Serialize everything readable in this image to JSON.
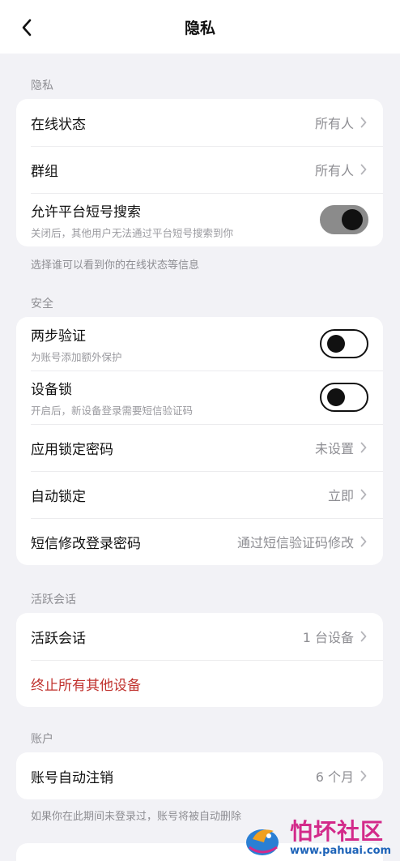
{
  "header": {
    "title": "隐私",
    "back_icon": "chevron-left-icon"
  },
  "privacy": {
    "label": "隐私",
    "online_status": {
      "title": "在线状态",
      "value": "所有人"
    },
    "groups": {
      "title": "群组",
      "value": "所有人"
    },
    "short_id_search": {
      "title": "允许平台短号搜索",
      "subtitle": "关闭后，其他用户无法通过平台短号搜索到你",
      "enabled": true
    },
    "footnote": "选择谁可以看到你的在线状态等信息"
  },
  "security": {
    "label": "安全",
    "two_step": {
      "title": "两步验证",
      "subtitle": "为账号添加额外保护",
      "enabled": false
    },
    "device_lock": {
      "title": "设备锁",
      "subtitle": "开启后，新设备登录需要短信验证码",
      "enabled": false
    },
    "app_lock_passcode": {
      "title": "应用锁定密码",
      "value": "未设置"
    },
    "auto_lock": {
      "title": "自动锁定",
      "value": "立即"
    },
    "sms_change_password": {
      "title": "短信修改登录密码",
      "value": "通过短信验证码修改"
    }
  },
  "sessions": {
    "label": "活跃会话",
    "active_sessions": {
      "title": "活跃会话",
      "value": "1 台设备"
    },
    "terminate_label": "终止所有其他设备"
  },
  "account": {
    "label": "账户",
    "auto_delete": {
      "title": "账号自动注销",
      "value": "6 个月"
    },
    "footnote": "如果你在此期间未登录过，账号将被自动删除"
  },
  "watermark": {
    "title": "怕坏社区",
    "url": "www.pahuai.com"
  },
  "colors": {
    "background": "#f2f2f6",
    "danger": "#c0322e",
    "toggle_on": "#8b8b8b",
    "watermark_pink": "#d32a8a",
    "watermark_blue": "#1d63b8"
  }
}
